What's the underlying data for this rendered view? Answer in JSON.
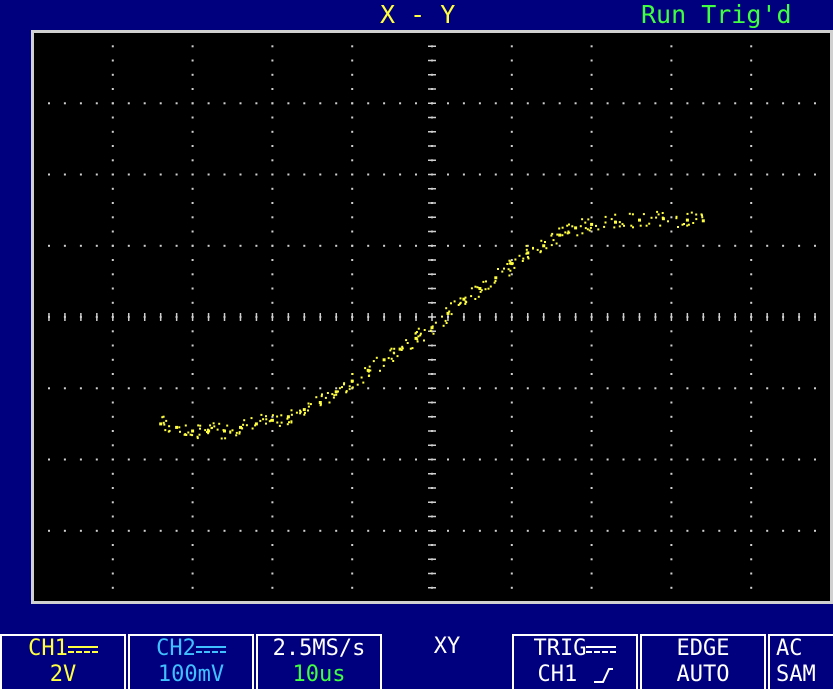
{
  "header": {
    "mode": "X - Y",
    "status": "Run Trig'd"
  },
  "chart_data": {
    "type": "scatter",
    "title": "",
    "xlabel": "",
    "ylabel": "",
    "grid": true,
    "divisions": {
      "x": 10,
      "y": 8
    },
    "xlim": [
      -5,
      5
    ],
    "ylim": [
      -4,
      4
    ],
    "series": [
      {
        "color": "#ffff40",
        "points": [
          [
            -3.4,
            -1.5
          ],
          [
            -3.2,
            -1.55
          ],
          [
            -3.0,
            -1.6
          ],
          [
            -2.8,
            -1.6
          ],
          [
            -2.6,
            -1.6
          ],
          [
            -2.4,
            -1.55
          ],
          [
            -2.2,
            -1.5
          ],
          [
            -2.0,
            -1.45
          ],
          [
            -1.8,
            -1.4
          ],
          [
            -1.6,
            -1.3
          ],
          [
            -1.4,
            -1.2
          ],
          [
            -1.2,
            -1.05
          ],
          [
            -1.0,
            -0.9
          ],
          [
            -0.8,
            -0.75
          ],
          [
            -0.6,
            -0.6
          ],
          [
            -0.4,
            -0.45
          ],
          [
            -0.2,
            -0.3
          ],
          [
            0.0,
            -0.15
          ],
          [
            0.2,
            0.05
          ],
          [
            0.4,
            0.25
          ],
          [
            0.6,
            0.4
          ],
          [
            0.8,
            0.55
          ],
          [
            1.0,
            0.75
          ],
          [
            1.2,
            0.9
          ],
          [
            1.4,
            1.0
          ],
          [
            1.6,
            1.15
          ],
          [
            1.8,
            1.25
          ],
          [
            2.0,
            1.3
          ],
          [
            2.3,
            1.33
          ],
          [
            2.6,
            1.36
          ],
          [
            2.9,
            1.38
          ],
          [
            3.2,
            1.36
          ],
          [
            3.4,
            1.35
          ]
        ]
      }
    ]
  },
  "footer": {
    "ch1": {
      "label": "CH1",
      "value": "2V"
    },
    "ch2": {
      "label": "CH2",
      "value": "100mV"
    },
    "timebase": {
      "rate": "2.5MS/s",
      "time": "10us"
    },
    "mode": {
      "label": "XY"
    },
    "trigger": {
      "label": "TRIG",
      "source": "CH1"
    },
    "edge": {
      "label": "EDGE",
      "mode": "AUTO"
    },
    "acq": {
      "label": "AC",
      "mode": "SAM"
    }
  },
  "colors": {
    "background": "#00007f",
    "screen": "#000000",
    "ch1": "#ffff40",
    "ch2": "#40c0ff",
    "status": "#40ff40",
    "grid": "#d0d0d0"
  }
}
